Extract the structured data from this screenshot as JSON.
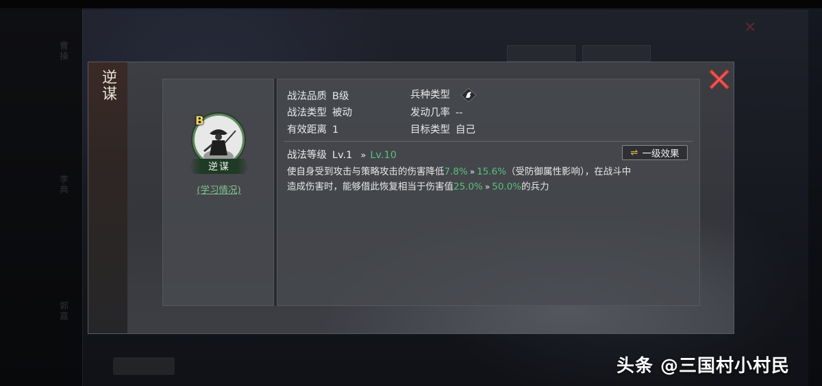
{
  "background_ghost": {
    "left_vertical_1": "曹操",
    "left_vertical_2": "李典",
    "left_vertical_3": "郭嘉"
  },
  "dialog": {
    "title": "逆谋",
    "close_icon": "close-x-icon",
    "skill": {
      "grade": "B",
      "name": "逆谋",
      "learn_link": "(学习情况)"
    },
    "info": {
      "quality_label": "战法品质",
      "quality_value": "B级",
      "troop_label": "兵种类型",
      "troop_icon": "horse-icon",
      "type_label": "战法类型",
      "type_value": "被动",
      "rate_label": "发动几率",
      "rate_value": "--",
      "range_label": "有效距离",
      "range_value": "1",
      "target_label": "目标类型",
      "target_value": "自己"
    },
    "level": {
      "label": "战法等级",
      "current": "Lv.1",
      "max": "Lv.10"
    },
    "effect_button": "一级效果",
    "description": {
      "part1": "使自身受到攻击与策略攻击的伤害降低",
      "pct1_from": "7.8%",
      "pct1_to": "15.6%",
      "part2": "（受防御属性影响），在战斗中",
      "part3": "造成伤害时，能够借此恢复相当于伤害值",
      "pct2_from": "25.0%",
      "pct2_to": "50.0%",
      "part4": "的兵力"
    }
  },
  "watermark": "头条 @三国村小村民",
  "colors": {
    "accent_green": "#58c17b",
    "close_red": "#d93a36",
    "grade_gold": "#f1d36a"
  }
}
